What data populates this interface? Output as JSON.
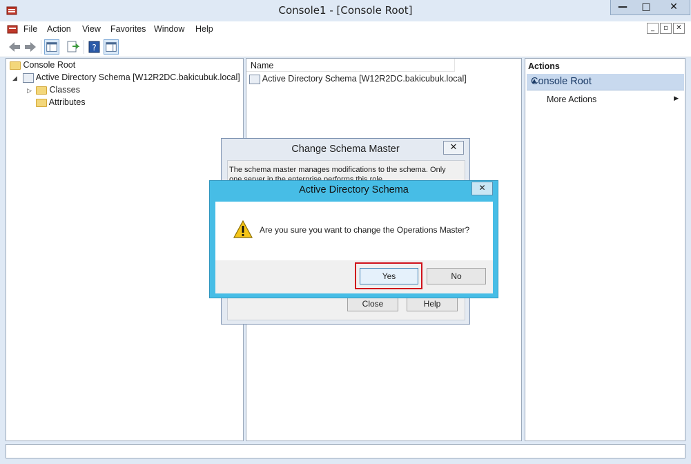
{
  "window": {
    "title": "Console1 - [Console Root]",
    "minimize": "—",
    "maximize": "□",
    "close": "✕"
  },
  "menu": {
    "items": [
      "File",
      "Action",
      "View",
      "Favorites",
      "Window",
      "Help"
    ]
  },
  "tree": {
    "root": "Console Root",
    "schema": "Active Directory Schema [W12R2DC.bakicubuk.local]",
    "children": [
      "Classes",
      "Attributes"
    ]
  },
  "list": {
    "column_name": "Name",
    "rows": [
      "Active Directory Schema [W12R2DC.bakicubuk.local]"
    ]
  },
  "actions": {
    "header": "Actions",
    "section": "Console Root",
    "more": "More Actions"
  },
  "dialog_back": {
    "title": "Change Schema Master",
    "text": "The schema master manages modifications to the schema. Only one server in the enterprise performs this role.",
    "close_label": "Close",
    "help_label": "Help"
  },
  "dialog_front": {
    "title": "Active Directory Schema",
    "message": "Are you sure you want to change the Operations Master?",
    "yes_label": "Yes",
    "no_label": "No"
  }
}
